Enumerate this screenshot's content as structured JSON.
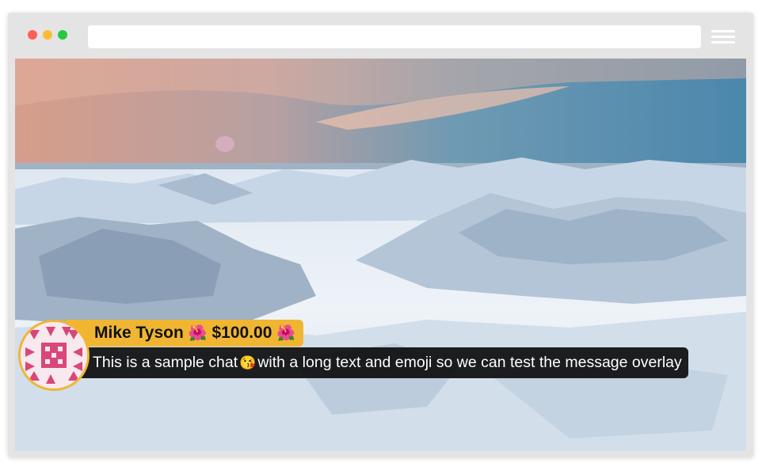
{
  "browser": {
    "url": "",
    "menu_icon": "hamburger-menu-icon"
  },
  "chat_overlay": {
    "username": "Mike Tyson",
    "amount": "$100.00",
    "amount_emoji": "🌺",
    "message_before": "This is a sample chat",
    "message_emoji": "😘",
    "message_after": "with a long text and emoji so we can test the message overlay",
    "accent_color": "#f0b632",
    "message_bg_color": "#0c0c0c",
    "avatar_icon": "pink-geometric-avatar-icon"
  }
}
